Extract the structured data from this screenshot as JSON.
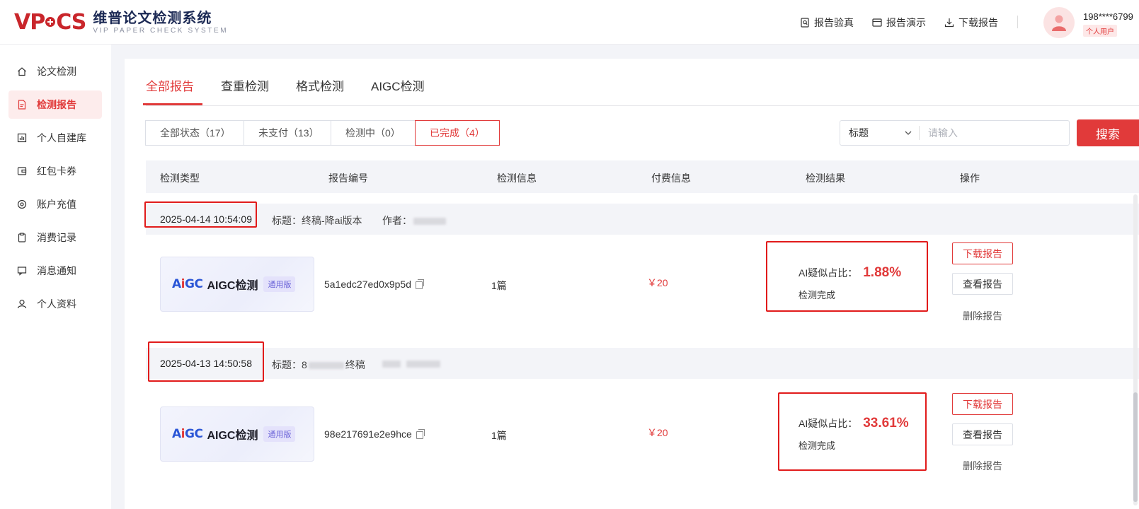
{
  "brand": {
    "mark": "VPCS",
    "name_cn": "维普论文检测系统",
    "name_en": "VIP PAPER CHECK SYSTEM"
  },
  "header": {
    "links": [
      {
        "label": "报告验真",
        "icon": "search-doc-icon"
      },
      {
        "label": "报告演示",
        "icon": "window-icon"
      },
      {
        "label": "下载报告",
        "icon": "download-icon"
      }
    ],
    "user": {
      "phone": "198****6799",
      "badge": "个人用户"
    }
  },
  "sidebar": {
    "items": [
      {
        "label": "论文检测",
        "icon": "home-icon",
        "active": false
      },
      {
        "label": "检测报告",
        "icon": "report-icon",
        "active": true
      },
      {
        "label": "个人自建库",
        "icon": "chart-icon",
        "active": false
      },
      {
        "label": "红包卡券",
        "icon": "wallet-icon",
        "active": false
      },
      {
        "label": "账户充值",
        "icon": "coin-icon",
        "active": false
      },
      {
        "label": "消费记录",
        "icon": "clipboard-icon",
        "active": false
      },
      {
        "label": "消息通知",
        "icon": "message-icon",
        "active": false
      },
      {
        "label": "个人资料",
        "icon": "user-icon",
        "active": false
      }
    ]
  },
  "tabs": [
    {
      "label": "全部报告",
      "active": true
    },
    {
      "label": "查重检测",
      "active": false
    },
    {
      "label": "格式检测",
      "active": false
    },
    {
      "label": "AIGC检测",
      "active": false
    }
  ],
  "filters": [
    {
      "label": "全部状态（17）",
      "active": false
    },
    {
      "label": "未支付（13）",
      "active": false
    },
    {
      "label": "检测中（0）",
      "active": false
    },
    {
      "label": "已完成（4）",
      "active": true
    }
  ],
  "search": {
    "select_value": "标题",
    "placeholder": "请输入",
    "button": "搜索"
  },
  "table": {
    "headers": [
      "检测类型",
      "报告编号",
      "检测信息",
      "付费信息",
      "检测结果",
      "操作"
    ],
    "rows": [
      {
        "date": "2025-04-14 10:54:09",
        "title_label": "标题：终稿-降ai版本",
        "author_label": "作者：",
        "card_title": "AIGC检测",
        "card_badge": "通用版",
        "report_id": "5a1edc27ed0x9p5d",
        "info": "1篇",
        "price": "￥20",
        "result_label": "AI疑似占比：",
        "result_value": "1.88%",
        "result_status": "检测完成"
      },
      {
        "date": "2025-04-13 14:50:58",
        "title_prefix": "标题：8",
        "title_suffix": "终稿",
        "card_title": "AIGC检测",
        "card_badge": "通用版",
        "report_id": "98e217691e2e9hce",
        "info": "1篇",
        "price": "￥20",
        "result_label": "AI疑似占比：",
        "result_value": "33.61%",
        "result_status": "检测完成"
      }
    ],
    "actions": {
      "download": "下载报告",
      "view": "查看报告",
      "delete": "删除报告"
    }
  },
  "colors": {
    "accent": "#e13a3a",
    "highlight_box": "#e11b1b",
    "brand_blue": "#2b56d6"
  }
}
